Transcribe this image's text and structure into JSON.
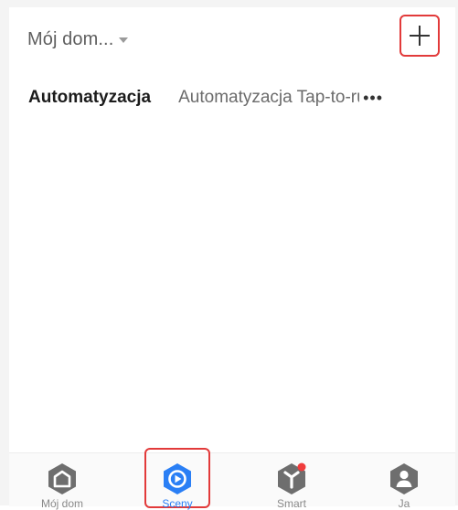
{
  "header": {
    "home_name": "Mój dom...",
    "caret_icon": "caret-down-icon",
    "add_icon": "plus-icon"
  },
  "tabs": {
    "items": [
      {
        "label": "Automatyzacja",
        "active": true
      },
      {
        "label": "Automatyzacja Tap-to-run",
        "active": false
      }
    ],
    "more_icon": "more-dots-icon",
    "more_label": "•••"
  },
  "bottom_nav": {
    "items": [
      {
        "label": "Mój dom",
        "icon": "home-icon",
        "active": false
      },
      {
        "label": "Sceny",
        "icon": "scenes-icon",
        "active": true
      },
      {
        "label": "Smart",
        "icon": "smart-icon",
        "active": false,
        "badge": true
      },
      {
        "label": "Ja",
        "icon": "user-icon",
        "active": false
      }
    ]
  },
  "colors": {
    "accent": "#2a7ff5",
    "icon_gray": "#6e6e6e",
    "highlight": "#e23a3a",
    "badge": "#f03c3c"
  }
}
